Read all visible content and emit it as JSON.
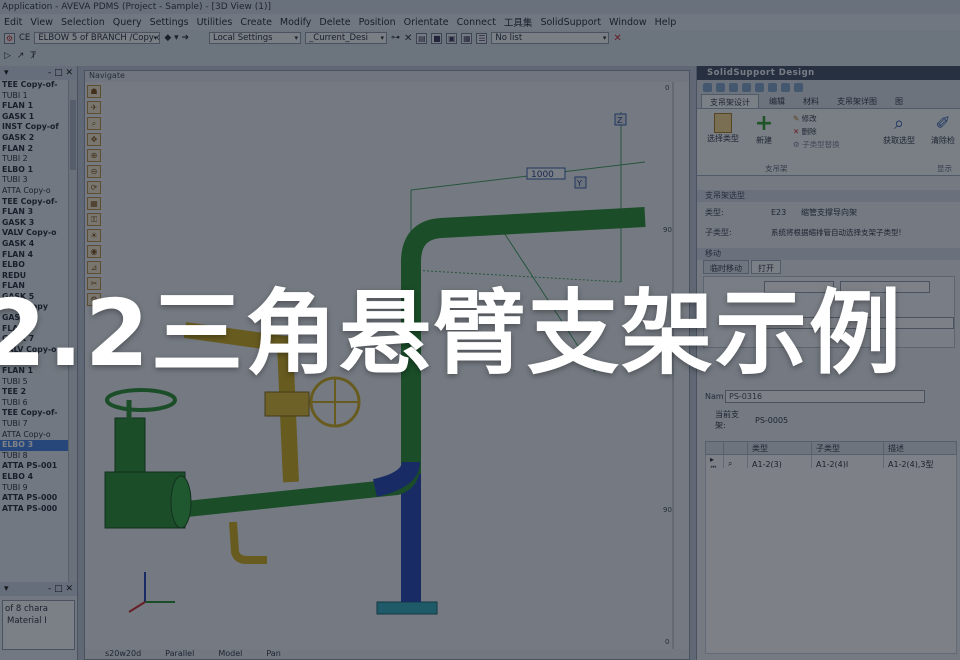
{
  "window": {
    "title": "Application - AVEVA PDMS (Project - Sample) - [3D View (1)]"
  },
  "menu": [
    "Edit",
    "View",
    "Selection",
    "Query",
    "Settings",
    "Utilities",
    "Create",
    "Modify",
    "Delete",
    "Position",
    "Orientate",
    "Connect",
    "工具集",
    "SolidSupport",
    "Window",
    "Help"
  ],
  "toolbar": {
    "ce_label": "CE",
    "ce_value": "ELBOW 5 of BRANCH /Copy-c",
    "settings_value": "Local Settings",
    "design_value": "_Current_Desi",
    "list_value": "No list"
  },
  "left_panel": {
    "controls": "- □ ✕",
    "items": [
      {
        "text": "TEE Copy-of-",
        "bold": true
      },
      {
        "text": "TUBI 1",
        "bold": false
      },
      {
        "text": "FLAN 1",
        "bold": true
      },
      {
        "text": "GASK 1",
        "bold": true
      },
      {
        "text": "INST Copy-of",
        "bold": true
      },
      {
        "text": "GASK 2",
        "bold": true
      },
      {
        "text": "FLAN 2",
        "bold": true
      },
      {
        "text": "TUBI 2",
        "bold": false
      },
      {
        "text": "ELBO 1",
        "bold": true
      },
      {
        "text": "TUBI 3",
        "bold": false
      },
      {
        "text": "ATTA Copy-o",
        "bold": false
      },
      {
        "text": "TEE Copy-of-",
        "bold": true
      },
      {
        "text": "FLAN 3",
        "bold": true
      },
      {
        "text": "GASK 3",
        "bold": true
      },
      {
        "text": "VALV Copy-o",
        "bold": true
      },
      {
        "text": "GASK 4",
        "bold": true
      },
      {
        "text": "FLAN 4",
        "bold": true
      },
      {
        "text": "ELBO",
        "bold": true
      },
      {
        "text": "REDU",
        "bold": true
      },
      {
        "text": "FLAN",
        "bold": true
      },
      {
        "text": "GASK 5",
        "bold": true
      },
      {
        "text": "VALV Copy",
        "bold": true
      },
      {
        "text": "GASK 6",
        "bold": true
      },
      {
        "text": "FLAN",
        "bold": true
      },
      {
        "text": "GASK 7",
        "bold": true
      },
      {
        "text": "VALV Copy-o",
        "bold": true
      },
      {
        "text": "GASK 8",
        "bold": true
      },
      {
        "text": "FLAN 1",
        "bold": true
      },
      {
        "text": "TUBI 5",
        "bold": false
      },
      {
        "text": "TEE 2",
        "bold": true
      },
      {
        "text": "TUBI 6",
        "bold": false
      },
      {
        "text": "TEE Copy-of-",
        "bold": true
      },
      {
        "text": "TUBI 7",
        "bold": false
      },
      {
        "text": "ATTA Copy-o",
        "bold": false
      },
      {
        "text": "ELBO 3",
        "bold": true,
        "selected": true
      },
      {
        "text": "TUBI 8",
        "bold": false
      },
      {
        "text": "ATTA PS-001",
        "bold": true
      },
      {
        "text": "ELBO 4",
        "bold": true
      },
      {
        "text": "TUBI 9",
        "bold": false
      },
      {
        "text": "ATTA PS-000",
        "bold": true
      },
      {
        "text": "ATTA PS-000",
        "bold": true
      }
    ]
  },
  "left_bottom": {
    "line1": "of 8 chara",
    "line2": "Material I"
  },
  "viewport": {
    "label": "Navigate",
    "dimension_text": "1000",
    "axis_z": "Z",
    "axis_y": "Y",
    "label_1": "1",
    "ruler_top": "0",
    "ruler_90a": "90",
    "ruler_90b": "90",
    "ruler_0b": "0",
    "status": [
      "s20w20d",
      "Parallel",
      "Model",
      "Pan"
    ],
    "colors": {
      "green_pipe": "#1f8a2a",
      "yellow_pipe": "#c9a81a",
      "blue_pipe": "#1c3fb0"
    }
  },
  "right_panel": {
    "title": "SolidSupport Design",
    "tabs": [
      "支吊架设计",
      "编辑",
      "材料",
      "支吊架详图",
      "图"
    ],
    "active_tab_index": 0,
    "ribbon": {
      "select_type": "选择类型",
      "create": "新建",
      "modify": "修改",
      "delete": "删除",
      "subtype_replace": "子类型替换",
      "get_selection": "获取选型",
      "clear": "清除检",
      "group_label": "支吊架",
      "group_label2": "显示"
    },
    "info_group": "支吊架选型",
    "type_label": "类型:",
    "type_value_code": "E23",
    "type_value_desc": "缩管支撑导向架",
    "subtype_label": "子类型:",
    "subtype_value": "系统将根据缩排管自动选择支架子类型!",
    "move_group": "移动",
    "move_tabs": [
      "临时移动",
      "打开"
    ],
    "name_label": "Nam",
    "name_value": "PS-0316",
    "current_support_label": "当前支架:",
    "current_support_value": "PS-0005",
    "grid_headers": [
      "类型",
      "子类型",
      "描述"
    ],
    "grid_rows": [
      [
        "A1-2(3)",
        "A1-2(4)I",
        "A1-2(4),3型"
      ]
    ]
  },
  "overlay": {
    "title": "2.2三角悬臂支架示例"
  }
}
